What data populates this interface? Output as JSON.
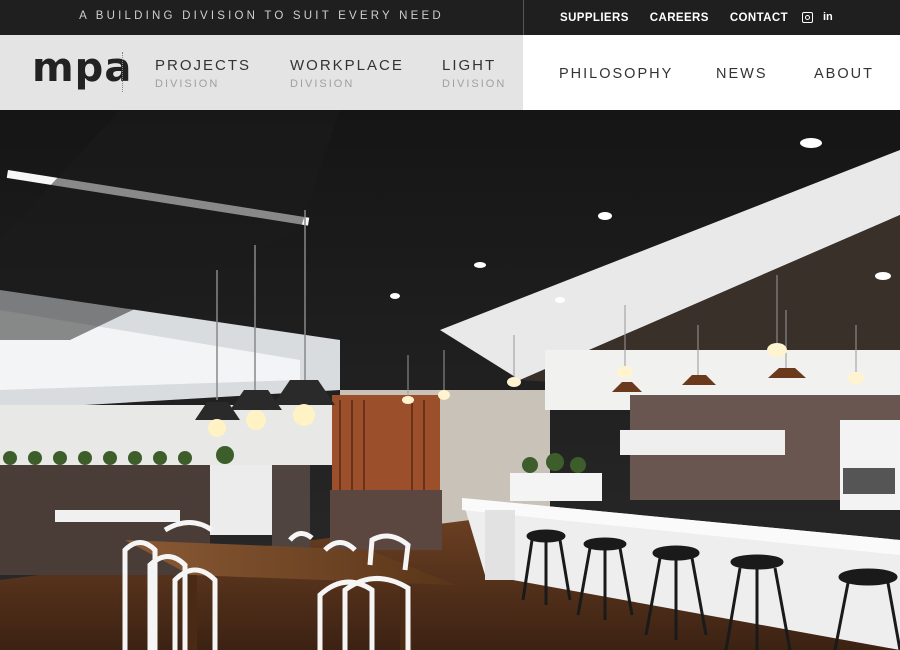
{
  "topbar": {
    "tagline": "A BUILDING DIVISION TO SUIT EVERY NEED",
    "links": [
      "SUPPLIERS",
      "CAREERS",
      "CONTACT"
    ],
    "social": {
      "linkedin_glyph": "in"
    }
  },
  "brand": {
    "logo": "mpa"
  },
  "divisions": [
    {
      "name": "PROJECTS",
      "sub": "DIVISION"
    },
    {
      "name": "WORKPLACE",
      "sub": "DIVISION"
    },
    {
      "name": "LIGHT",
      "sub": "DIVISION"
    }
  ],
  "nav": [
    "PHILOSOPHY",
    "NEWS",
    "ABOUT"
  ],
  "colors": {
    "topbar": "#1f1f1f",
    "division_bar": "#e4e4e4",
    "accent_text": "#333333"
  },
  "icons": [
    "instagram-icon",
    "linkedin-icon"
  ]
}
